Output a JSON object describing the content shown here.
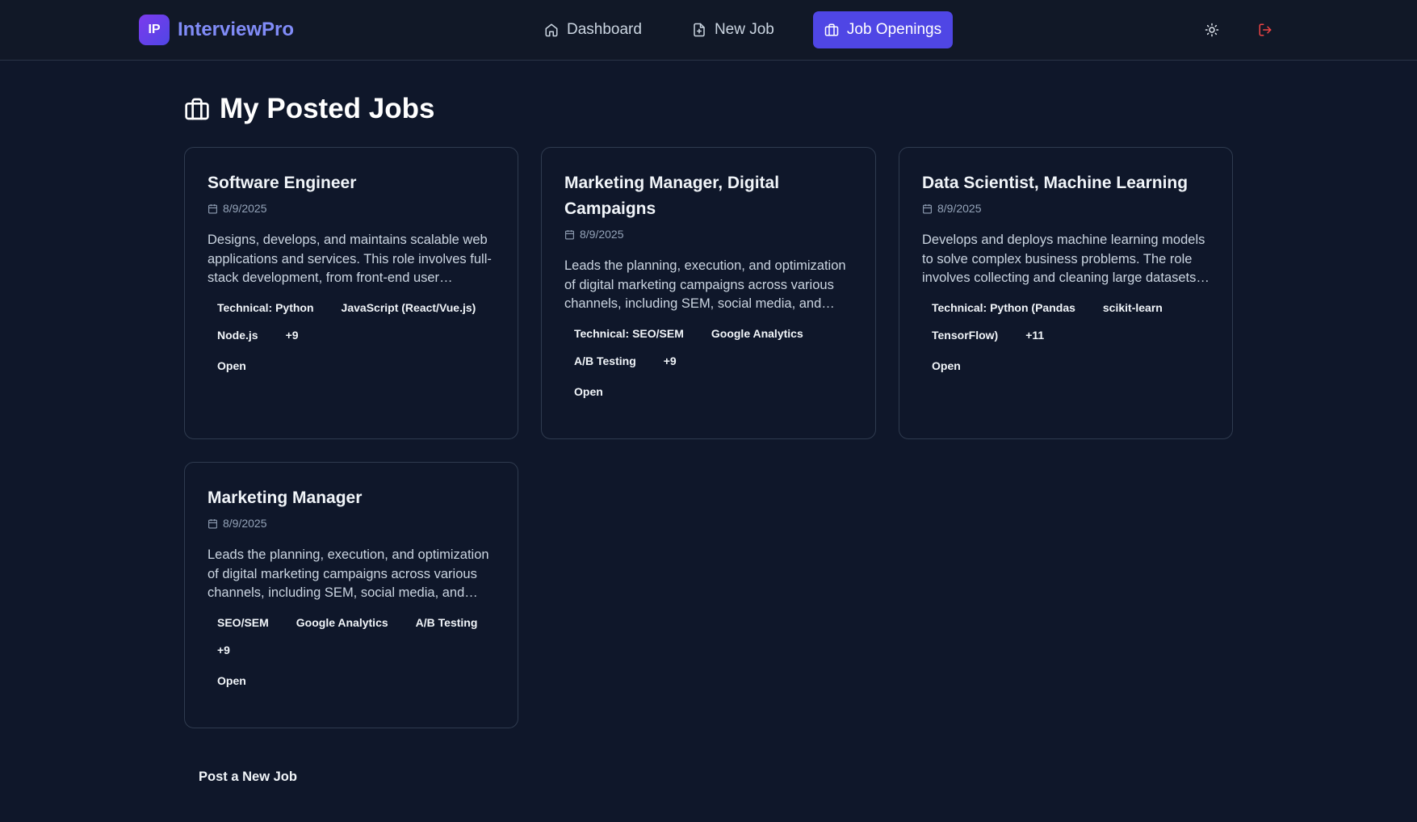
{
  "app": {
    "logo_text": "IP",
    "name": "InterviewPro"
  },
  "nav": {
    "items": [
      {
        "label": "Dashboard",
        "icon": "home-icon"
      },
      {
        "label": "New Job",
        "icon": "file-plus-icon"
      },
      {
        "label": "Job Openings",
        "icon": "briefcase-icon",
        "active": true
      }
    ],
    "actions": [
      {
        "name": "theme-toggle",
        "icon": "sun-icon"
      },
      {
        "name": "logout",
        "icon": "log-out-icon",
        "color": "#ef4444"
      }
    ]
  },
  "page": {
    "title": "My Posted Jobs",
    "title_icon": "briefcase-icon"
  },
  "jobs": [
    {
      "title": "Software Engineer",
      "date": "8/9/2025",
      "description": "Designs, develops, and maintains scalable web applications and services. This role involves full-stack development, from front-end user interfaces to back-end services.",
      "tags": [
        "Technical: Python",
        "JavaScript (React/Vue.js)",
        "Node.js",
        "+9"
      ],
      "status": "Open"
    },
    {
      "title": "Marketing Manager, Digital Campaigns",
      "date": "8/9/2025",
      "description": "Leads the planning, execution, and optimization of digital marketing campaigns across various channels, including SEM, social media, and email marketing.",
      "tags": [
        "Technical: SEO/SEM",
        "Google Analytics",
        "A/B Testing",
        "+9"
      ],
      "status": "Open"
    },
    {
      "title": "Data Scientist, Machine Learning",
      "date": "8/9/2025",
      "description": "Develops and deploys machine learning models to solve complex business problems. The role involves collecting and cleaning large datasets, building models.",
      "tags": [
        "Technical: Python (Pandas",
        "scikit-learn",
        "TensorFlow)",
        "+11"
      ],
      "status": "Open"
    },
    {
      "title": "Marketing Manager",
      "date": "8/9/2025",
      "description": "Leads the planning, execution, and optimization of digital marketing campaigns across various channels, including SEM, social media, and email marketing.",
      "tags": [
        "SEO/SEM",
        "Google Analytics",
        "A/B Testing",
        "+9"
      ],
      "status": "Open"
    }
  ],
  "actions": {
    "post_new_job": "Post a New Job"
  },
  "colors": {
    "background": "#0f172a",
    "navbar": "#111827",
    "accent": "#4f46e5",
    "brand": "#818cf8",
    "logout": "#ef4444"
  }
}
